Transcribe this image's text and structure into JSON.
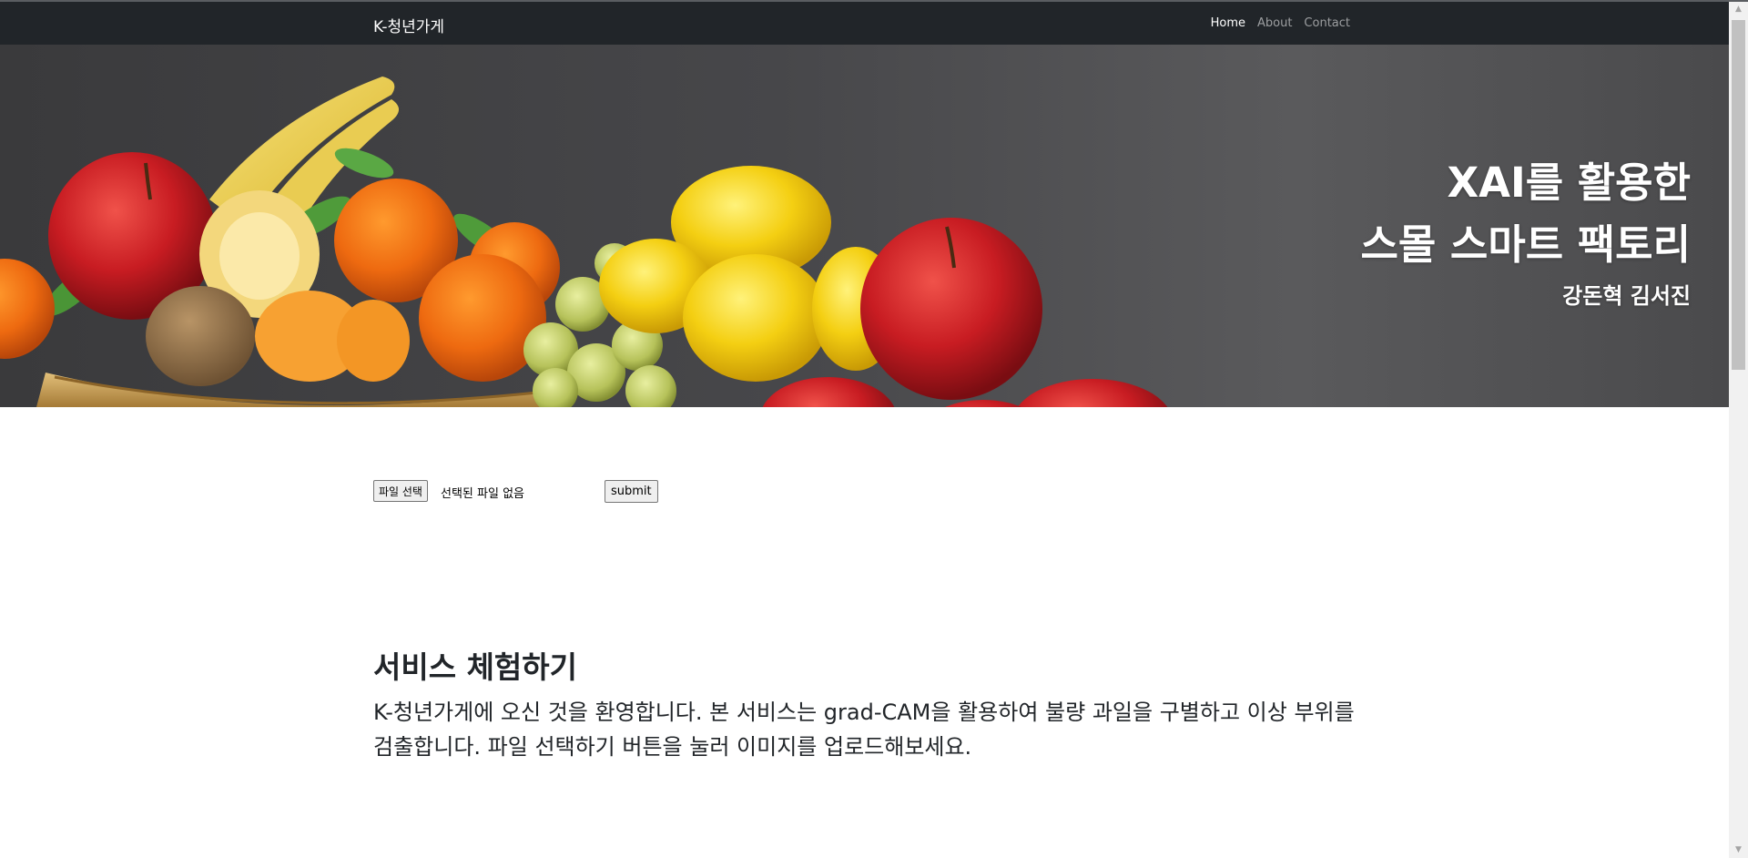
{
  "navbar": {
    "brand": "K-청년가게",
    "links": [
      "Home",
      "About",
      "Contact"
    ],
    "active": "Home"
  },
  "hero": {
    "title_line1": "XAI를 활용한",
    "title_line2": "스몰 스마트 팩토리",
    "authors": "강돈혁 김서진"
  },
  "upload": {
    "file_button_label": "파일 선택",
    "file_status": "선택된 파일 없음",
    "submit_label": "submit"
  },
  "service": {
    "heading": "서비스 체험하기",
    "description": "K-청년가게에 오신 것을 환영합니다. 본 서비스는 grad-CAM을 활용하여 불량 과일을 구별하고 이상 부위를 검출합니다. 파일 선택하기 버튼을 눌러 이미지를 업로드해보세요."
  },
  "colors": {
    "navbar_bg": "#212529",
    "text": "#212529"
  }
}
